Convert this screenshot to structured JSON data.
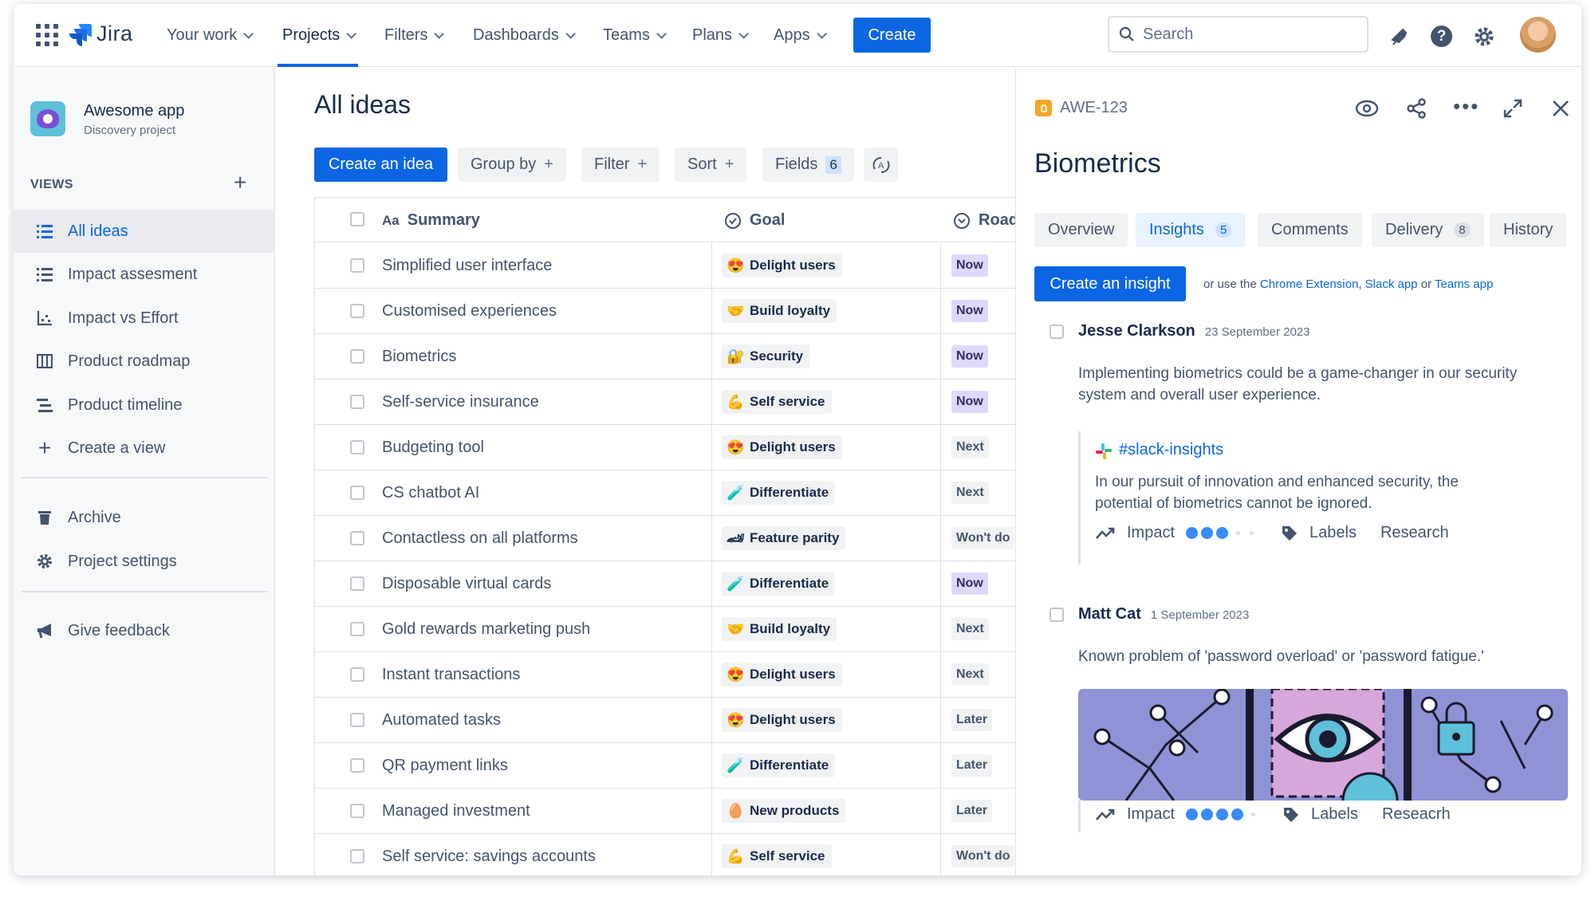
{
  "topnav": {
    "logo_text": "Jira",
    "items": [
      {
        "label": "Your work"
      },
      {
        "label": "Projects"
      },
      {
        "label": "Filters"
      },
      {
        "label": "Dashboards"
      },
      {
        "label": "Teams"
      },
      {
        "label": "Plans"
      },
      {
        "label": "Apps"
      }
    ],
    "create_label": "Create",
    "search_placeholder": "Search"
  },
  "sidebar": {
    "project_name": "Awesome app",
    "project_type": "Discovery project",
    "views_heading": "VIEWS",
    "views": [
      {
        "label": "All ideas",
        "icon": "list-icon",
        "selected": true
      },
      {
        "label": "Impact assesment",
        "icon": "list-icon"
      },
      {
        "label": "Impact vs Effort",
        "icon": "matrix-icon"
      },
      {
        "label": "Product roadmap",
        "icon": "board-icon"
      },
      {
        "label": "Product timeline",
        "icon": "timeline-icon"
      },
      {
        "label": "Create a view",
        "icon": "plus-icon"
      }
    ],
    "archive_label": "Archive",
    "settings_label": "Project settings",
    "feedback_label": "Give feedback"
  },
  "main": {
    "title": "All ideas",
    "create_idea_label": "Create an idea",
    "group_by_label": "Group by",
    "filter_label": "Filter",
    "sort_label": "Sort",
    "fields_label": "Fields",
    "fields_count": "6",
    "columns": {
      "summary": "Summary",
      "goal": "Goal",
      "roadmap": "Roadm"
    },
    "rows": [
      {
        "summary": "Simplified user interface",
        "goal": "Delight users",
        "goal_emoji": "😍",
        "roadmap": "Now",
        "status": "now"
      },
      {
        "summary": "Customised experiences",
        "goal": "Build loyalty",
        "goal_emoji": "🤝",
        "roadmap": "Now",
        "status": "now"
      },
      {
        "summary": "Biometrics",
        "goal": "Security",
        "goal_emoji": "🔐",
        "roadmap": "Now",
        "status": "now"
      },
      {
        "summary": "Self-service insurance",
        "goal": "Self service",
        "goal_emoji": "💪",
        "roadmap": "Now",
        "status": "now"
      },
      {
        "summary": "Budgeting tool",
        "goal": "Delight users",
        "goal_emoji": "😍",
        "roadmap": "Next",
        "status": "next"
      },
      {
        "summary": "CS chatbot AI",
        "goal": "Differentiate",
        "goal_emoji": "🧪",
        "roadmap": "Next",
        "status": "next"
      },
      {
        "summary": "Contactless on all platforms",
        "goal": "Feature parity",
        "goal_emoji": "🏎",
        "roadmap": "Won't do",
        "status": "wont"
      },
      {
        "summary": "Disposable virtual cards",
        "goal": "Differentiate",
        "goal_emoji": "🧪",
        "roadmap": "Now",
        "status": "now"
      },
      {
        "summary": "Gold rewards marketing push",
        "goal": "Build loyalty",
        "goal_emoji": "🤝",
        "roadmap": "Next",
        "status": "next"
      },
      {
        "summary": "Instant transactions",
        "goal": "Delight users",
        "goal_emoji": "😍",
        "roadmap": "Next",
        "status": "next"
      },
      {
        "summary": "Automated tasks",
        "goal": "Delight users",
        "goal_emoji": "😍",
        "roadmap": "Later",
        "status": "later"
      },
      {
        "summary": "QR payment links",
        "goal": "Differentiate",
        "goal_emoji": "🧪",
        "roadmap": "Later",
        "status": "later"
      },
      {
        "summary": "Managed investment",
        "goal": "New products",
        "goal_emoji": "🥚",
        "roadmap": "Later",
        "status": "later"
      },
      {
        "summary": "Self service: savings accounts",
        "goal": "Self service",
        "goal_emoji": "💪",
        "roadmap": "Won't do",
        "status": "wont"
      }
    ]
  },
  "panel": {
    "issue_key": "AWE-123",
    "title": "Biometrics",
    "tabs": [
      {
        "label": "Overview",
        "count": ""
      },
      {
        "label": "Insights",
        "count": "5"
      },
      {
        "label": "Comments",
        "count": ""
      },
      {
        "label": "Delivery",
        "count": "8"
      },
      {
        "label": "History",
        "count": ""
      }
    ],
    "create_insight_label": "Create an insight",
    "use_prefix": "or use the",
    "chrome_ext": "Chrome Extension",
    "comma": ",",
    "slack_app": "Slack app",
    "or_text": "or",
    "teams_app": "Teams app",
    "insights": [
      {
        "author": "Jesse Clarkson",
        "date": "23 September 2023",
        "text": "Implementing biometrics could be a game-changer in our security system and overall user experience.",
        "channel": "#slack-insights",
        "quote": "In our pursuit of innovation and enhanced security, the potential of biometrics cannot be ignored.",
        "impact_label": "Impact",
        "impact_level": 3,
        "labels_label": "Labels",
        "tag": "Research"
      },
      {
        "author": "Matt Cat",
        "date": "1 September 2023",
        "text": "Known problem of 'password overload' or 'password fatigue.'",
        "impact_label": "Impact",
        "impact_level": 4,
        "labels_label": "Labels",
        "tag": "Reseacrh"
      }
    ]
  },
  "colors": {
    "accent": "#0c66e4",
    "now_badge": "#dfd8fd",
    "illustration_bg": "#8f93d6"
  }
}
